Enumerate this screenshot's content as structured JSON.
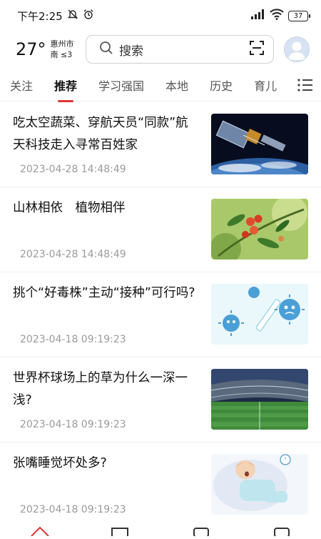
{
  "status": {
    "time": "下午2:25",
    "battery": "37"
  },
  "header": {
    "temperature": "27°",
    "city": "惠州市",
    "wind": "南 ≤3",
    "search_placeholder": "搜索"
  },
  "tabs": [
    "关注",
    "推荐",
    "学习强国",
    "本地",
    "历史",
    "育儿"
  ],
  "active_tab": 1,
  "articles": [
    {
      "title": "吃太空蔬菜、穿航天员“同款”航天科技走入寻常百姓家",
      "time": "2023-04-28 14:48:49",
      "image": "satellite-over-earth"
    },
    {
      "title": "山林相依　植物相伴",
      "time": "2023-04-28 14:48:49",
      "image": "red-berries-branch"
    },
    {
      "title": "挑个“好毒株”主动“接种”可行吗?",
      "time": "2023-04-18 09:19:23",
      "image": "virus-cartoon-syringe"
    },
    {
      "title": "世界杯球场上的草为什么一深一浅?",
      "time": "2023-04-18 09:19:23",
      "image": "football-stadium"
    },
    {
      "title": "张嘴睡觉坏处多?",
      "time": "2023-04-18 09:19:23",
      "image": "sleeping-child-cartoon"
    }
  ]
}
